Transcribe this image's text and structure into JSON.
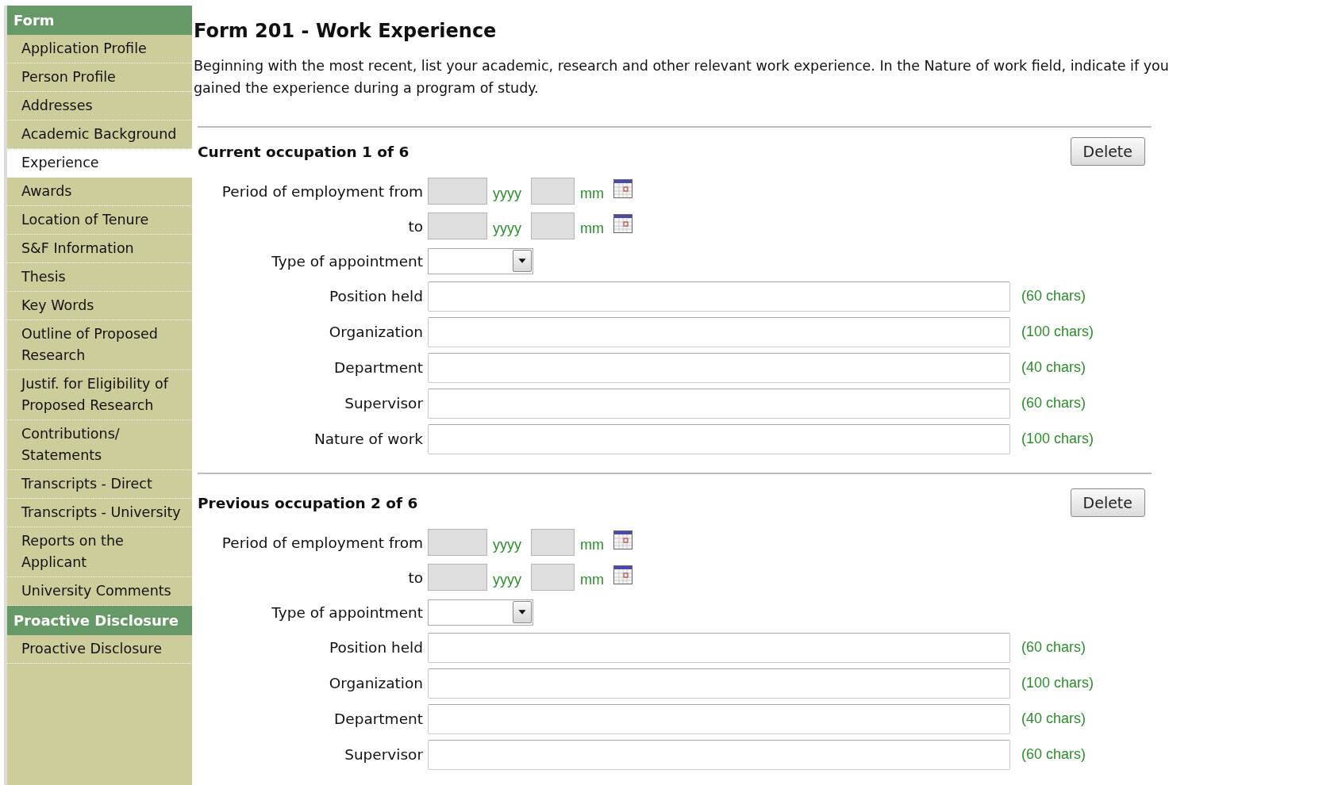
{
  "sidebar": {
    "groups": [
      {
        "title": "Form",
        "items": [
          {
            "label": "Application Profile",
            "selected": false
          },
          {
            "label": "Person Profile",
            "selected": false
          },
          {
            "label": "Addresses",
            "selected": false
          },
          {
            "label": "Academic Background",
            "selected": false
          },
          {
            "label": "Experience",
            "selected": true
          },
          {
            "label": "Awards",
            "selected": false
          },
          {
            "label": "Location of Tenure",
            "selected": false
          },
          {
            "label": "S&F Information",
            "selected": false
          },
          {
            "label": "Thesis",
            "selected": false
          },
          {
            "label": "Key Words",
            "selected": false
          },
          {
            "label": "Outline of Proposed Research",
            "selected": false
          },
          {
            "label": "Justif. for Eligibility of Proposed Research",
            "selected": false
          },
          {
            "label": "Contributions/ Statements",
            "selected": false
          },
          {
            "label": "Transcripts - Direct",
            "selected": false
          },
          {
            "label": "Transcripts - University",
            "selected": false
          },
          {
            "label": "Reports on the Applicant",
            "selected": false
          },
          {
            "label": "University Comments",
            "selected": false
          }
        ]
      },
      {
        "title": "Proactive Disclosure",
        "items": [
          {
            "label": "Proactive Disclosure",
            "selected": false
          }
        ]
      }
    ]
  },
  "page": {
    "title": "Form 201 - Work Experience",
    "intro": "Beginning with the most recent, list your academic, research and other relevant work experience. In the Nature of work field, indicate if you gained the experience during a program of study."
  },
  "occupations": [
    {
      "heading": "Current occupation 1 of 6",
      "delete_button": "Delete",
      "dates": [
        {
          "label": "Period of employment from",
          "year_unit": "yyyy",
          "month_unit": "mm"
        },
        {
          "label": "to",
          "year_unit": "yyyy",
          "month_unit": "mm"
        }
      ],
      "appointment_label": "Type of appointment",
      "fields": [
        {
          "label": "Position held",
          "hint": "(60 chars)"
        },
        {
          "label": "Organization",
          "hint": "(100 chars)"
        },
        {
          "label": "Department",
          "hint": "(40 chars)"
        },
        {
          "label": "Supervisor",
          "hint": "(60 chars)"
        },
        {
          "label": "Nature of work",
          "hint": "(100 chars)"
        }
      ]
    },
    {
      "heading": "Previous occupation 2 of 6",
      "delete_button": "Delete",
      "dates": [
        {
          "label": "Period of employment from",
          "year_unit": "yyyy",
          "month_unit": "mm"
        },
        {
          "label": "to",
          "year_unit": "yyyy",
          "month_unit": "mm"
        }
      ],
      "appointment_label": "Type of appointment",
      "fields": [
        {
          "label": "Position held",
          "hint": "(60 chars)"
        },
        {
          "label": "Organization",
          "hint": "(100 chars)"
        },
        {
          "label": "Department",
          "hint": "(40 chars)"
        },
        {
          "label": "Supervisor",
          "hint": "(60 chars)"
        }
      ]
    }
  ]
}
